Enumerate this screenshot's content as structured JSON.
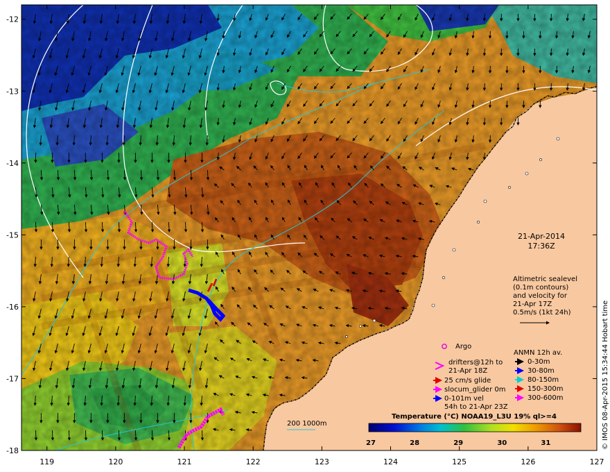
{
  "map": {
    "lon_ticks": [
      "119",
      "120",
      "121",
      "122",
      "123",
      "124",
      "125",
      "126",
      "127"
    ],
    "lat_ticks": [
      "-12",
      "-13",
      "-14",
      "-15",
      "-16",
      "-17",
      "-18"
    ],
    "date": "21-Apr-2014",
    "time": "17:36Z",
    "altimetry": {
      "lines": [
        "Altimetric sealevel",
        "(0.1m contours)",
        "and velocity for",
        "21-Apr 17Z",
        "0.5m/s (1kt 24h)"
      ]
    },
    "legend_left": {
      "argo": "Argo",
      "drifters": [
        "drifters@12h to",
        "21-Apr 18Z"
      ],
      "glide": "25 cm/s glide",
      "slocum": "slocum_glider 0m",
      "vel": [
        "0-101m vel",
        "54h to 21-Apr 23Z"
      ]
    },
    "legend_right": {
      "title": "ANMN 12h av.",
      "items": [
        {
          "label": "0-30m",
          "color": "#000000"
        },
        {
          "label": "30-80m",
          "color": "#0000ff"
        },
        {
          "label": "80-150m",
          "color": "#00e0e0"
        },
        {
          "label": "150-300m",
          "color": "#ff0000"
        },
        {
          "label": "300-600m",
          "color": "#ff00ff"
        }
      ]
    },
    "colorbar": {
      "title": "Temperature (°C) NOAA19_L3U 19% ql>=4",
      "ticks": [
        "27",
        "28",
        "29",
        "30",
        "31"
      ]
    },
    "isobaths": "200  1000m",
    "credit": "© IMOS 08-Apr-2015 15:34:44 Hobart time",
    "colors": {
      "land": "#f8c8a0",
      "warm": "#c85a10",
      "hot": "#a8300a",
      "mid": "#f0a020",
      "yellow": "#c8e030",
      "green": "#40c040",
      "cool": "#18a0c8",
      "cold": "#1020a0"
    }
  }
}
